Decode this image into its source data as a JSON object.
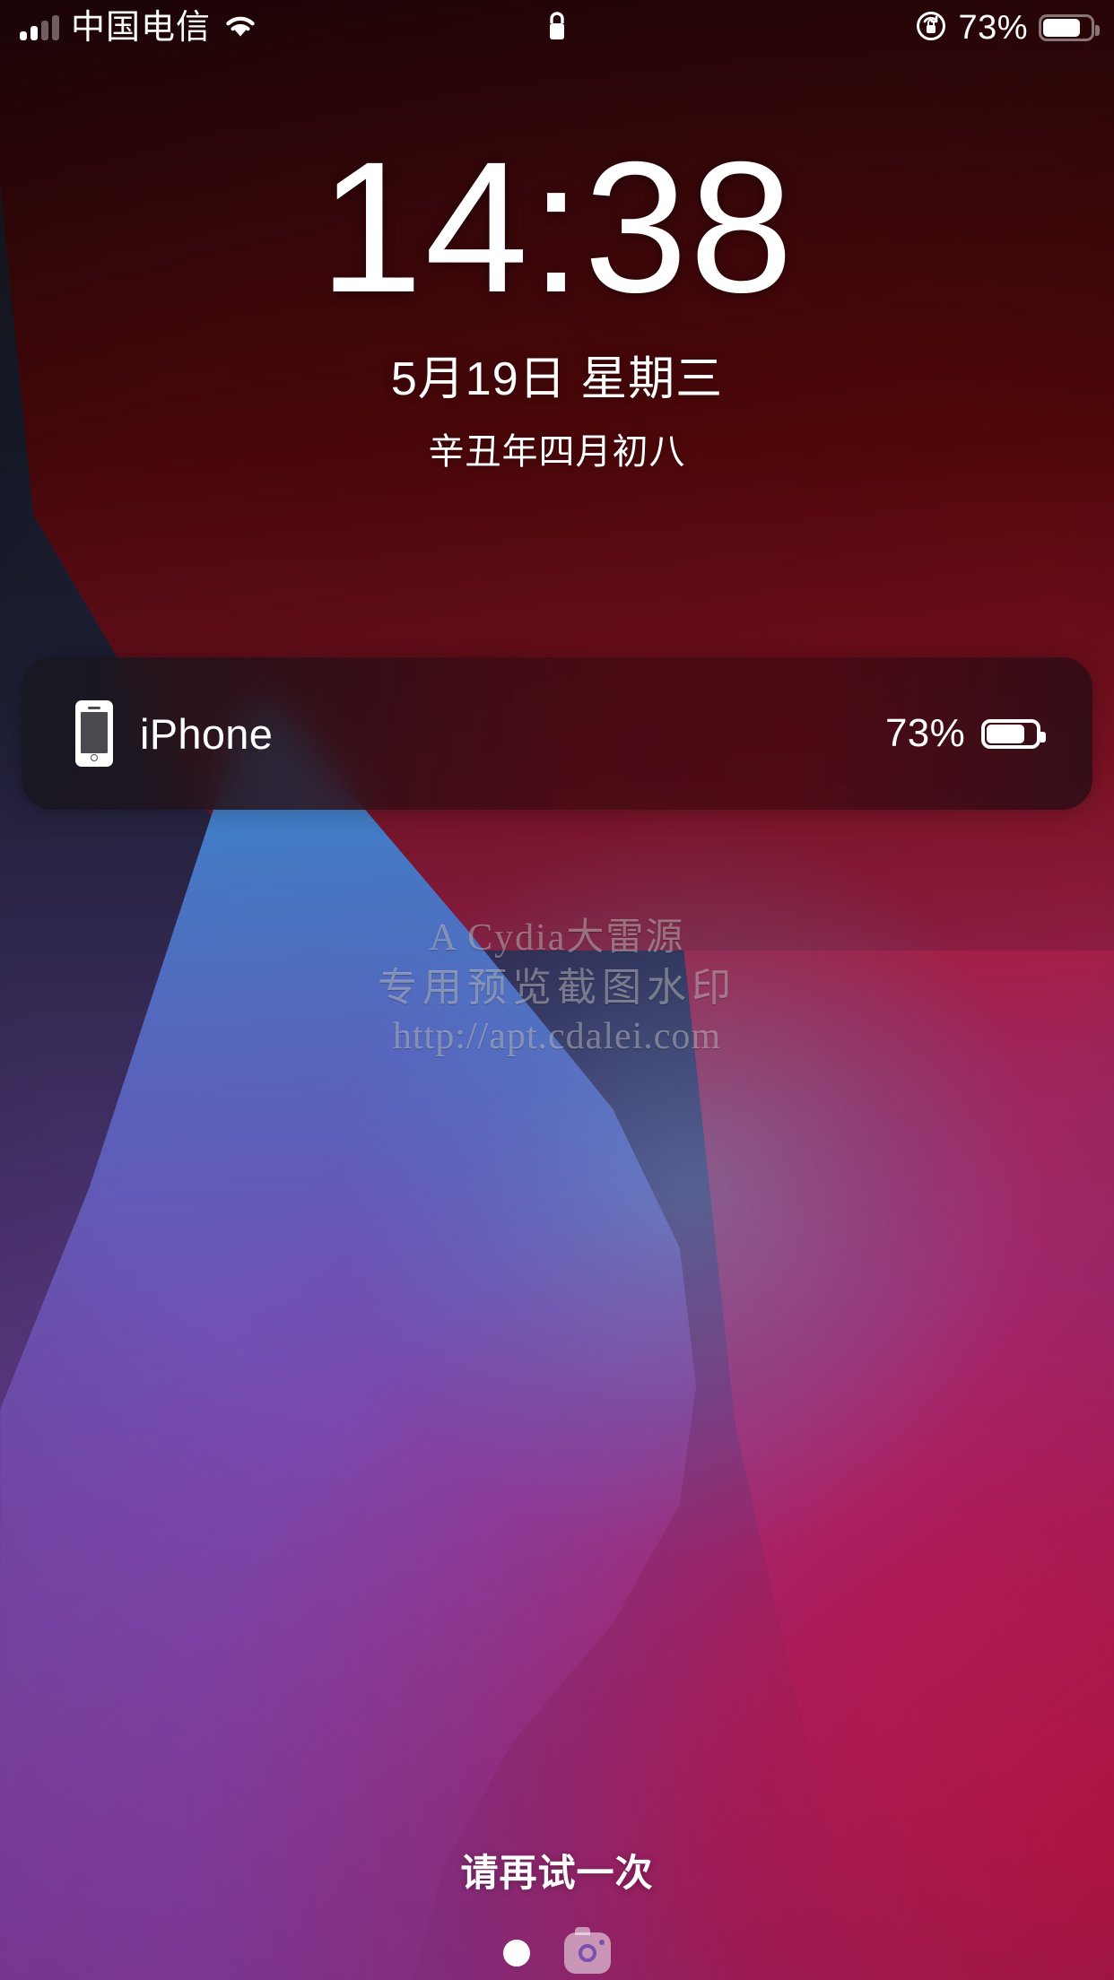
{
  "status_bar": {
    "carrier": "中国电信",
    "signal_icon": "signal-bars-icon",
    "wifi_icon": "wifi-icon",
    "lock_icon": "lock-icon",
    "rotation_lock_icon": "rotation-lock-icon",
    "battery_percent": "73%",
    "battery_level": 73,
    "battery_icon": "battery-icon"
  },
  "clock": {
    "time": "14:38",
    "date": "5月19日 星期三",
    "lunar_date": "辛丑年四月初八"
  },
  "battery_widget": {
    "device_icon": "iphone-icon",
    "device_name": "iPhone",
    "battery_percent": "73%",
    "battery_level": 73,
    "battery_icon": "battery-icon"
  },
  "watermark": {
    "line1": "A Cydia大雷源",
    "line2": "专用预览截图水印",
    "line3": "http://apt.cdalei.com"
  },
  "bottom": {
    "retry_message": "请再试一次",
    "home_indicator_icon": "home-dot-icon",
    "camera_icon": "camera-icon"
  },
  "colors": {
    "red": "#c4101c",
    "crimson": "#b61350",
    "navy": "#161a27",
    "cyan": "#2fc8e0",
    "blue": "#4773c4",
    "purple": "#8350ae",
    "text_white": "#ffffff",
    "card_tint": "#2a1018"
  }
}
